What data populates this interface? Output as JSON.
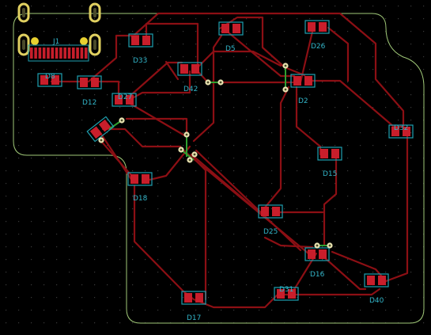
{
  "app": {
    "title": "PCB Editor"
  },
  "colors": {
    "background": "#000000",
    "grid_dot": "#3a3a3a",
    "outline": "#a0c878",
    "track": "#8c0f14",
    "pad": "#c81e2b",
    "pad_outline": "#1fa0b0",
    "label": "#32b4c8",
    "via_ring": "#e8e2b0",
    "via_hole": "#4a4a2a",
    "mount_ring": "#e0d060",
    "green_track": "#30a030"
  },
  "components": [
    {
      "ref": "J1"
    },
    {
      "ref": "D8"
    },
    {
      "ref": "D12"
    },
    {
      "ref": "D33"
    },
    {
      "ref": "D5"
    },
    {
      "ref": "D27"
    },
    {
      "ref": "D42"
    },
    {
      "ref": "D26"
    },
    {
      "ref": "D2"
    },
    {
      "ref": "D32"
    },
    {
      "ref": "D15"
    },
    {
      "ref": "D18"
    },
    {
      "ref": "D25"
    },
    {
      "ref": "D16"
    },
    {
      "ref": "D31"
    },
    {
      "ref": "D40"
    },
    {
      "ref": "D17"
    }
  ]
}
